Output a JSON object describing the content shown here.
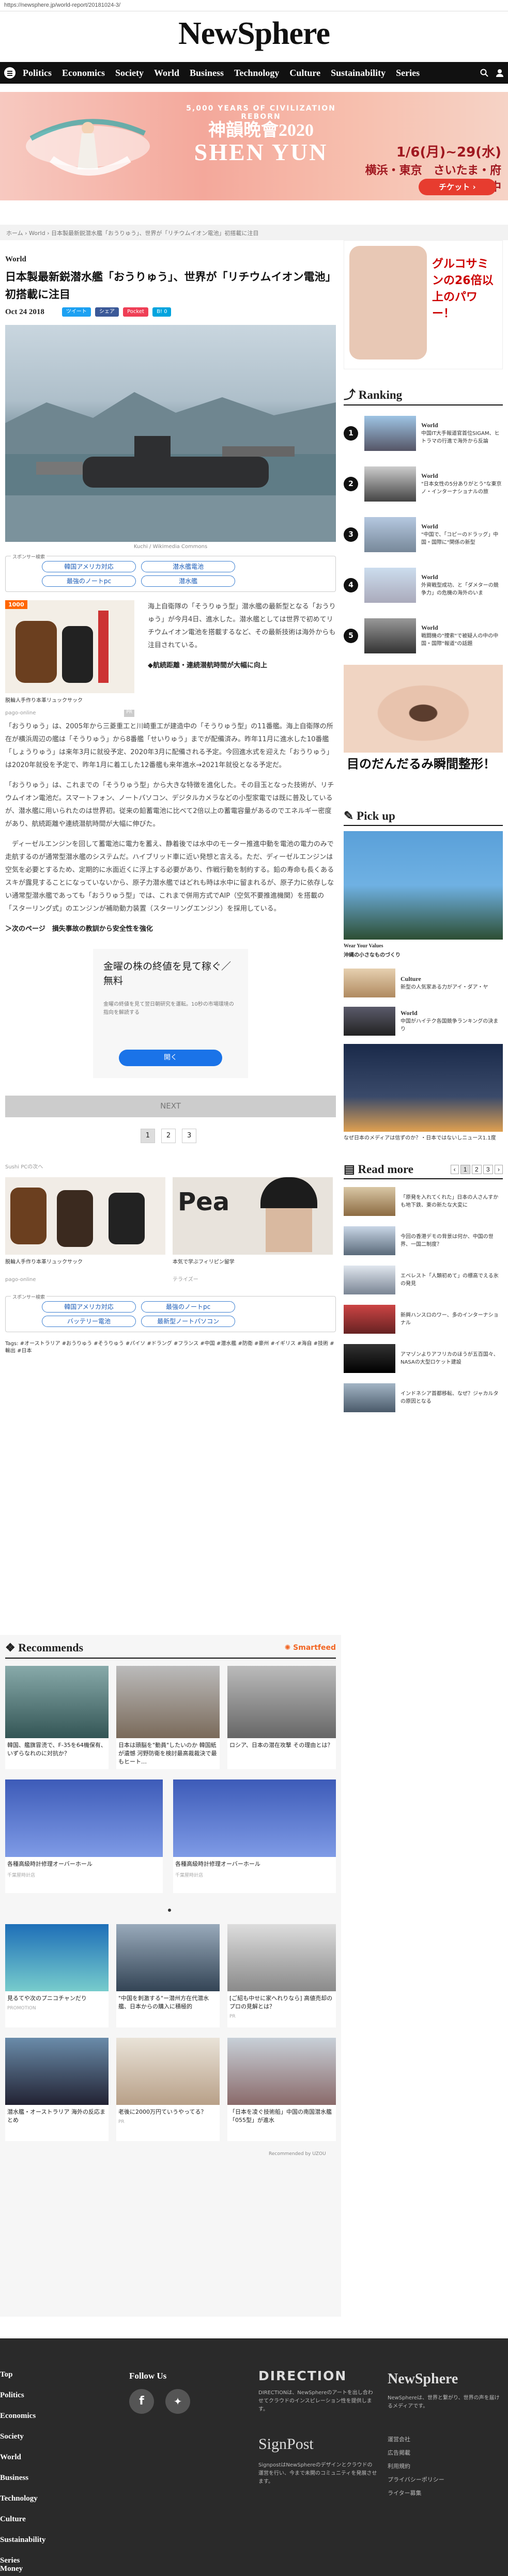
{
  "url": "https://newsphere.jp/world-report/20181024-3/",
  "site_name": "NewSphere",
  "nav": [
    "Top",
    "Politics",
    "Economics",
    "Society",
    "World",
    "Business",
    "Technology",
    "Culture",
    "Sustainability",
    "Series"
  ],
  "banner": {
    "line1": "5,000 YEARS OF CIVILIZATION REBORN",
    "line2": "神韻晩會2020",
    "line3": "SHEN YUN",
    "dates": "1/6(月)~29(水)",
    "venue": "横浜・東京　さいたま・府中",
    "cta": "チケット ›"
  },
  "breadcrumb": "ホーム  ›  World  ›  日本製最新鋭潜水艦「おうりゅう」、世界が「リチウムイオン電池」初搭載に注目",
  "article": {
    "category": "World",
    "title": "日本製最新鋭潜水艦「おうりゅう」、世界が「リチウムイオン電池」初搭載に注目",
    "date": "Oct 24 2018",
    "share": [
      "ツイート",
      "シェア",
      "Pocket",
      "B! 0"
    ],
    "caption": "Kuchi / Wikimedia Commons",
    "sponsor_label": "スポンサー検索",
    "sponsor_pills": [
      "韓国アメリカ対応",
      "潜水艦電池",
      "最強のノートpc",
      "潜水艦"
    ],
    "ad1_text": "脱輪人手作り本革リュックサック",
    "ad1_src": "pago-online",
    "ad1_tag": "PR",
    "p1": "海上自衛隊の「そうりゅう型」潜水艦の最新型となる「おうりゅう」が今月4日、進水した。潜水艦としては世界で初めてリチウムイオン電池を搭載するなど、その最新技術は海外からも注目されている。",
    "subhead": "◆航続距離・連続潜航時間が大幅に向上",
    "p2": "「おうりゅう」は、2005年から三菱重工と川崎重工が建造中の「そうりゅう型」の11番艦。海上自衛隊の所在が横浜周辺の艦は「そうりゅう」から8番艦「せいりゅう」までが配備済み。昨年11月に進水した10番艦「しょうりゅう」は来年3月に就役予定、2020年3月に配備される予定。今回進水式を迎えた「おうりゅう」は2020年就役を予定で、昨年1月に着工した12番艦も来年進水→2021年就役となる予定だ。",
    "p3": "「おうりゅう」は、これまでの「そうりゅう型」から大きな特徴を進化した。その目玉となった技術が、リチウムイオン電池だ。スマートフォン、ノートパソコン、デジタルカメラなどの小型家電では既に普及しているが、潜水艦に用いられたのは世界初。従来の鉛蓄電池に比べて2倍以上の蓄電容量があるのでエネルギー密度があり、航続距離や連続潜航時間が大幅に伸びた。",
    "p4": "　ディーゼルエンジンを回して蓄電池に電力を蓄え、静着後では水中のモーター推進中動を電池の電力のみで走航するのが通常型潜水艦のシステムだ。ハイブリッド車に近い発想と言える。ただ、ディーゼルエンジンは空気を必要とするため、定期的に水面近くに浮上する必要があり、作戦行動を制約する。鉛の寿命も長くあるスキが露見することになっていないから、原子力潜水艦ではどれも時は水中に留まれるが、原子力に依存しない通常型潜水艦であっても「おうりゅう型」では、これまで併用方式でAIP（空気不要推進機関）を搭載の「スターリング式」のエンジンが補助動力装置（スターリングエンジン）を採用している。",
    "next_link": "＞次のページ　損失事故の教訓から安全性を強化",
    "next_btn": "NEXT",
    "pages": [
      "1",
      "2",
      "3"
    ]
  },
  "ad_box": {
    "title": "金曜の株の終値を見て稼ぐ／無料",
    "sub": "金曜の終値を見て翌日朝研究を運転。10秒の市場環境の指向を解読する",
    "btn": "開く"
  },
  "related_label": "Sushi PCの次へ",
  "related": [
    {
      "text": "脱輪人手作り本革リュックサック",
      "src": "pago-online"
    },
    {
      "text": "本気で学ぶフィリピン留学",
      "src": "テライズー"
    }
  ],
  "sponsor2": [
    "韓国アメリカ対応",
    "最強のノートpc",
    "バッテリー電池",
    "最新型ノートパソコン"
  ],
  "tags": "Tags: #オーストラリア #おうりゅう #そうりゅう #パイソ #ドラング #フランス #中国 #潜水艦 #防衛 #豪州 #イギリス #海自 #技術 #輸出 #日本",
  "recommends_label": "Recommends",
  "smartfeed": "Smartfeed",
  "rec_cards": [
    {
      "text": "韓国、艦旗冒涜で、F-35を64機保有、いずらなれのに対抗か？",
      "src": ""
    },
    {
      "text": "日本は頭脳を\"動員\"したいのか 韓国紙が遺憾 河野防衛を検討最高裁裁決で最もヒート…",
      "src": ""
    },
    {
      "text": "ロシア、日本の潜在攻撃   その理由とは？",
      "src": ""
    },
    {
      "text": "各種高級時計修理オーバーホール",
      "src": "千葉屋時計店"
    },
    {
      "text": "各種高級時計修理オーバーホール",
      "src": "千葉屋時計店"
    }
  ],
  "rec_grid": [
    {
      "text": "見るてや次のプニコチャンだり",
      "src": "PROMOTION"
    },
    {
      "text": "\"中国を刺激する\"ー潜州方在代潜水艦、日本からの購入に積極的",
      "src": ""
    },
    {
      "text": "[ご紹も中せに家へれりなら] 高値売却のプロの見解とは？",
      "src": "PR"
    },
    {
      "text": "潜水艦・オーストラリア  海外の反応まとめ",
      "src": ""
    },
    {
      "text": "老後に2000万円ていうやってる？",
      "src": "PR"
    },
    {
      "text": "「日本を凌ぐ技術船」中国の南国潜水艦「055型」が進水",
      "src": ""
    }
  ],
  "uzou": "Recommended by UZOU",
  "sidebar": {
    "ad_top": "グルコサミンの26倍以上のパワー！",
    "ranking_label": "Ranking",
    "ranking": [
      {
        "num": "1",
        "cat": "World",
        "text": "中国IT大手報道官首位SIGAM、ヒトラマの行進で海外から反論"
      },
      {
        "num": "2",
        "cat": "World",
        "text": "\"日本女性の5分ありがとう\"な東京ノ・インターナショナルの旅"
      },
      {
        "num": "3",
        "cat": "World",
        "text": "\"中国で、「コピーのドラッグ」中国・国際に\"関係の新型"
      },
      {
        "num": "4",
        "cat": "World",
        "text": "外資戦型成功、と「ダメターの競争力」の危機の海外のいま"
      },
      {
        "num": "5",
        "cat": "World",
        "text": "戦闘機の\"捜索\"で被疑人の中の中国・国際\"報道\"の話題"
      }
    ],
    "ad_eye": "目のだんだるみ瞬間整形！",
    "pickup_label": "Pick up",
    "pickup_brand": "Wear Your Values",
    "pickup_title": "沖縄の小さなものづくり",
    "pickup_items": [
      {
        "cat": "Culture",
        "text": "新型の人気家ある力がアイ・ダア・ヤ"
      },
      {
        "cat": "World",
        "text": "中国がハイテク各国競争ランキングの決まり"
      }
    ],
    "ad_night": "なぜ日本のメディアは信ずのか？・日本ではないしニュース1.1度",
    "readmore_label": "Read more",
    "readmore_pages": [
      "1",
      "2",
      "3"
    ],
    "readmore": [
      "「原発を入れてくれた」日本の人さんすかも地下鉄、東の新たな大変に",
      "今回の香港デモの背景は何か、中国の世界、一国二制度？",
      "エベレスト「人類初めて」の標高でえる氷の発見",
      "新興ハンスロのワー、多のインターナショナル",
      "アマゾンよりアフリカのほうが五百国々、NASAの大型ロケット建設",
      "インドネシア首都移転、なぜ？ジャカルタの原因となる"
    ]
  },
  "footer": {
    "nav": [
      "Top",
      "Politics",
      "Economics",
      "Society",
      "World",
      "Business",
      "Technology",
      "Culture",
      "Sustainability",
      "Series",
      "Money"
    ],
    "follow": "Follow Us",
    "direction_title": "DIRECTION",
    "direction_text": "DIRECTIONは、NewSphereのアートを出し合わせてクラウドのインスピレーション性を提供します。",
    "signpost": "SignPost",
    "signpost_text": "SignpostはNewSphereのデザインとクラウドの運営を行い、今まで未開のコミュニティを発展させます。",
    "ns_title": "NewSphere",
    "ns_text": "NewSphereは、世界と繋がり、世界の声を届けるメディアです。",
    "links": [
      "運営会社",
      "広告掲載",
      "利用規約",
      "プライバシーポリシー",
      "ライター募集"
    ]
  }
}
